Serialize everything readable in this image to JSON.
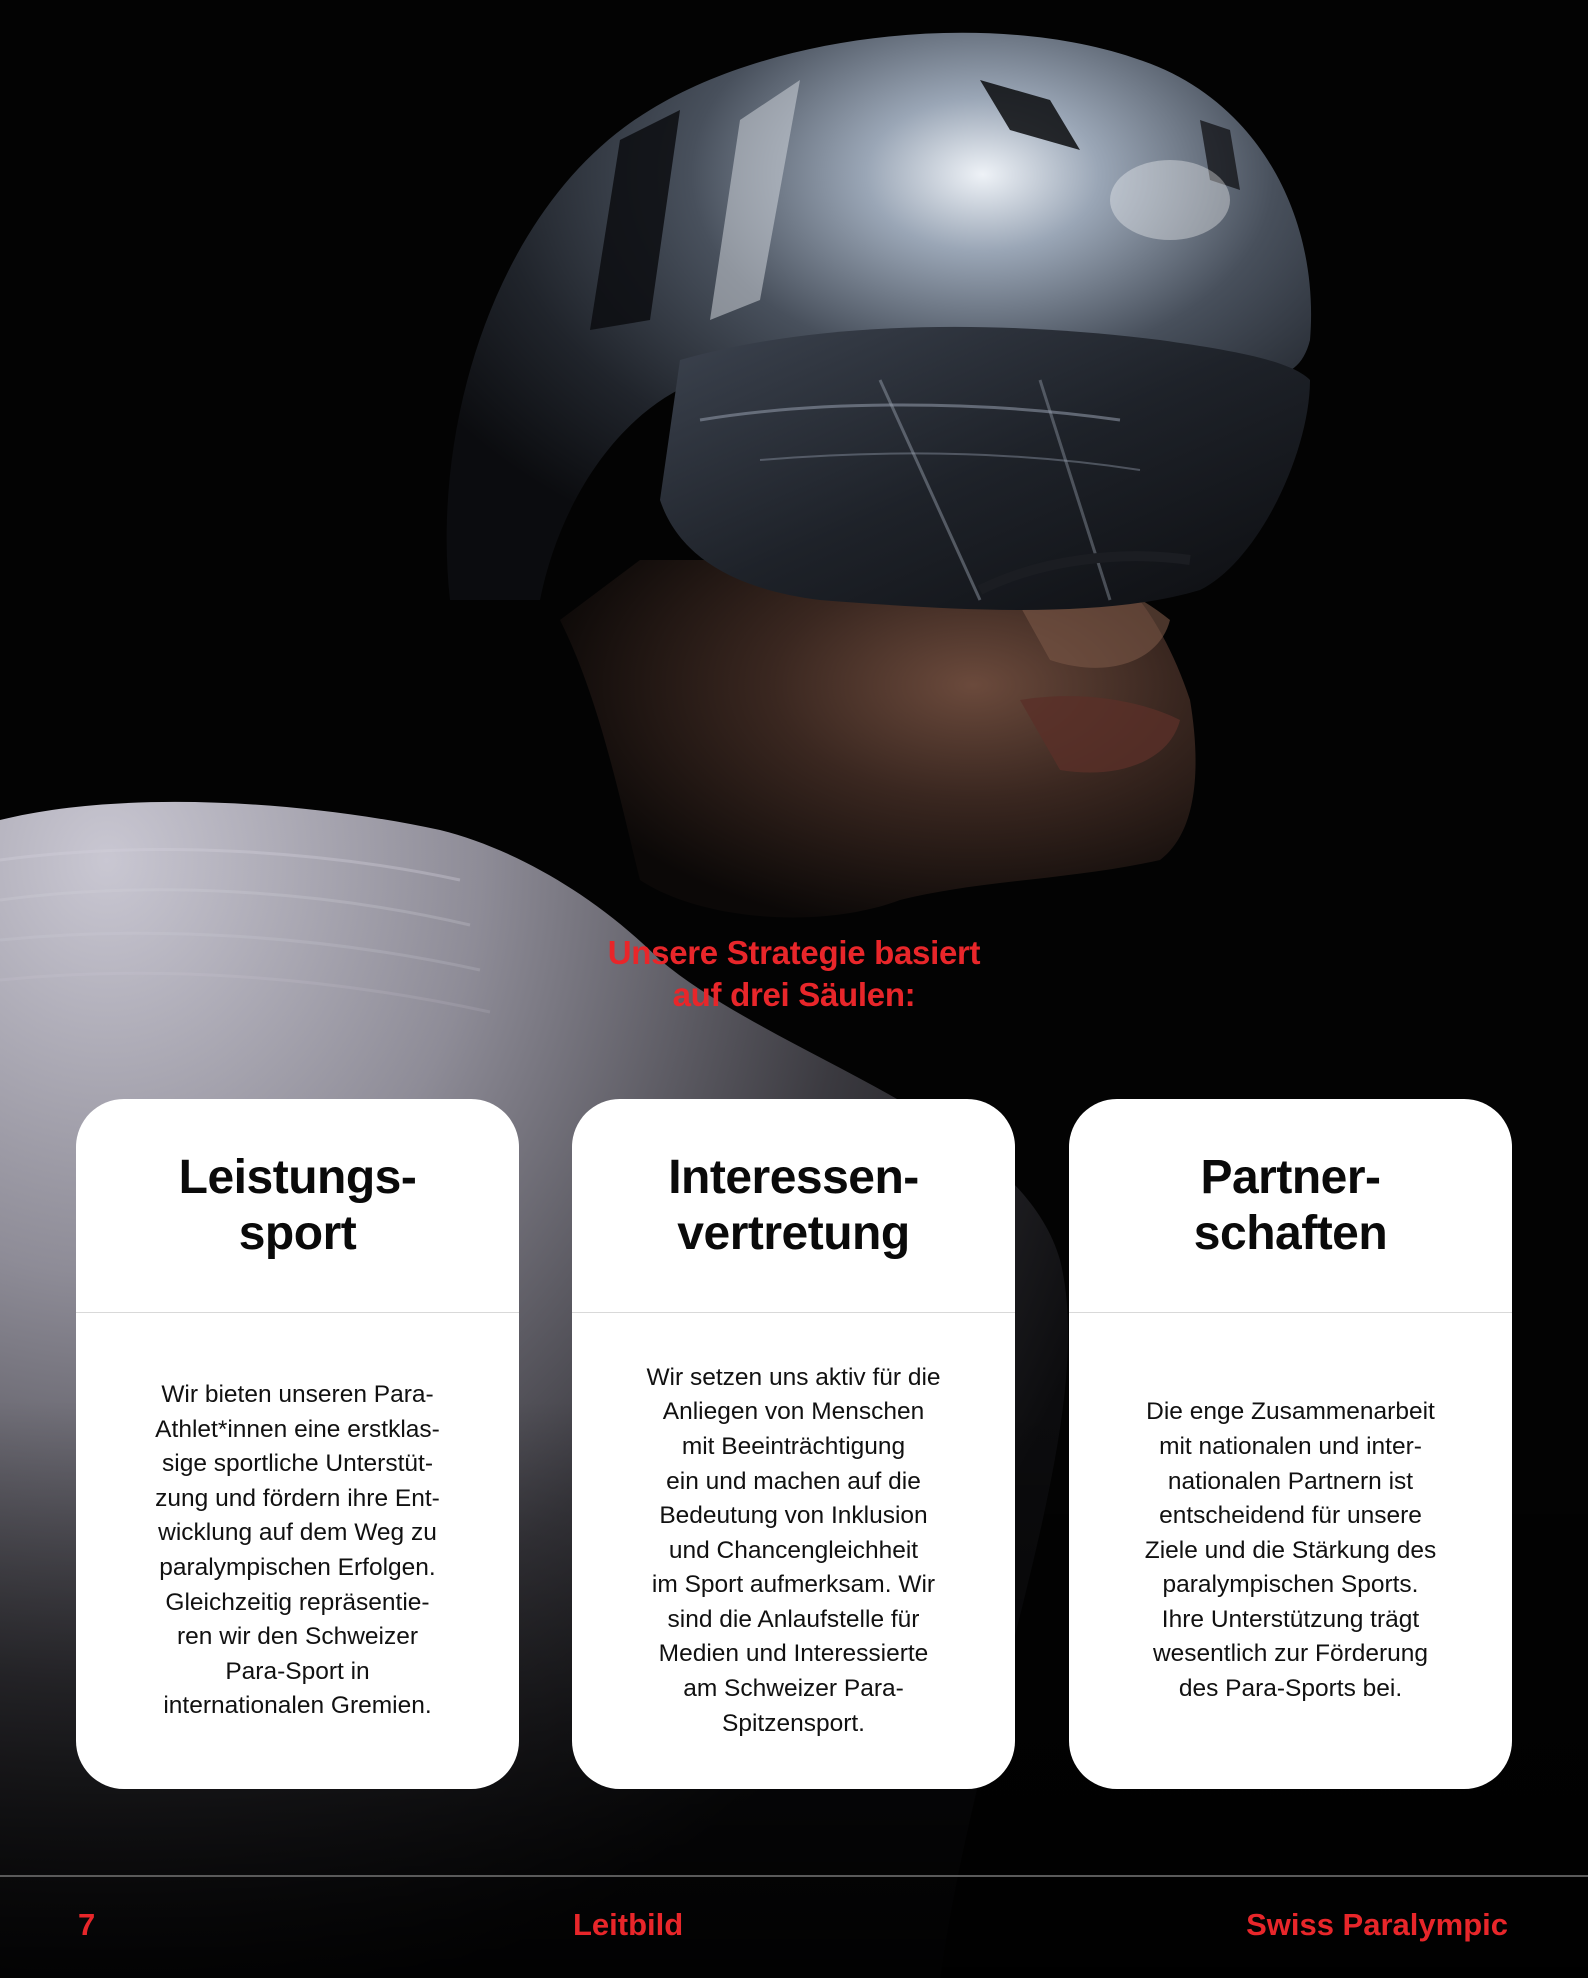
{
  "colors": {
    "accent": "#e8262a",
    "card_background": "#ffffff",
    "page_background": "#030303"
  },
  "intro": {
    "lines": [
      "Unsere Strategie basiert",
      "auf drei Säulen:"
    ]
  },
  "cards": [
    {
      "title_lines": [
        "Leistungs-",
        "sport"
      ],
      "text_lines": [
        "Wir bieten unseren Para-",
        "Athlet*innen eine erstklas-",
        "sige sportliche Unterstüt-",
        "zung und fördern ihre Ent-",
        "wicklung auf dem Weg zu",
        "paralympischen Erfolgen.",
        "Gleichzeitig repräsentie-",
        "ren wir den Schweizer",
        "Para-Sport in",
        "internationalen Gremien."
      ]
    },
    {
      "title_lines": [
        "Interessen-",
        "vertretung"
      ],
      "text_lines": [
        "Wir setzen uns aktiv für die",
        "Anliegen von Menschen",
        "mit Beeinträchtigung",
        "ein und machen auf die",
        "Bedeutung von Inklusion",
        "und Chancengleichheit",
        "im Sport aufmerksam. Wir",
        "sind die Anlaufstelle für",
        "Medien und Interessierte",
        "am Schweizer Para-",
        "Spitzensport."
      ]
    },
    {
      "title_lines": [
        "Partner-",
        "schaften"
      ],
      "text_lines": [
        "Die enge Zusammenarbeit",
        "mit nationalen und inter-",
        "nationalen Partnern ist",
        "entscheidend für unsere",
        "Ziele und die Stärkung des",
        "paralympischen Sports.",
        "Ihre Unterstützung trägt",
        "wesentlich zur Förderung",
        "des Para-Sports bei."
      ]
    }
  ],
  "footer": {
    "page_number": "7",
    "section": "Leitbild",
    "brand": "Swiss Paralympic"
  }
}
